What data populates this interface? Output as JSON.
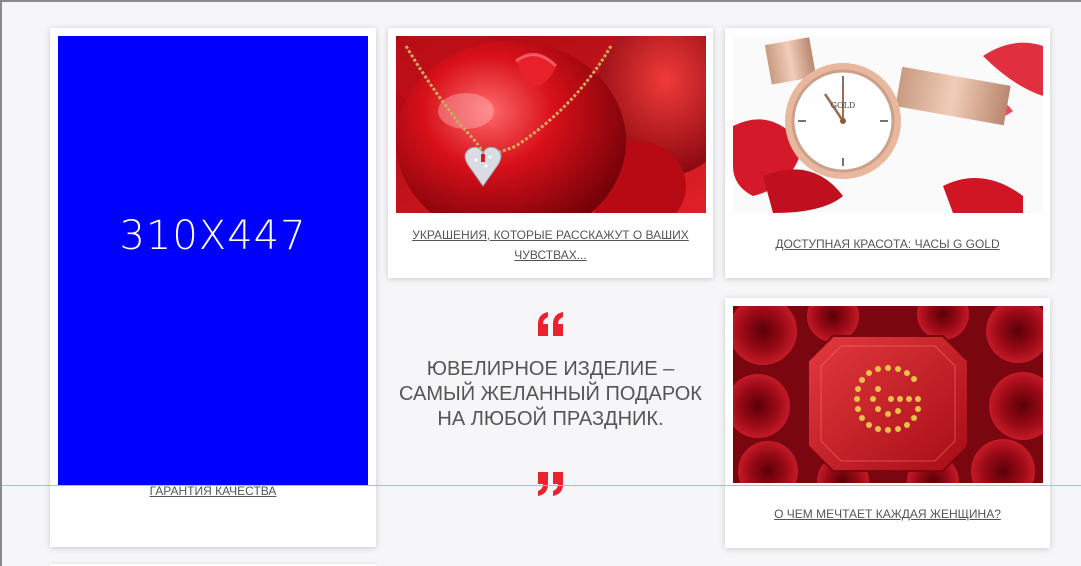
{
  "placeholder": {
    "label": "310X447",
    "color": "#0000ff",
    "link": "ГАРАНТИЯ КАЧЕСТВА"
  },
  "cards": {
    "necklace": {
      "link": "УКРАШЕНИЯ, КОТОРЫЕ РАССКАЖУТ О ВАШИХ ЧУВСТВАХ..."
    },
    "watch": {
      "link": "ДОСТУПНАЯ КРАСОТА: ЧАСЫ G GOLD"
    },
    "box": {
      "link": "О ЧЕМ МЕЧТАЕТ КАЖДАЯ ЖЕНЩИНА?",
      "logo_letter": "G"
    }
  },
  "quote": {
    "text": "ЮВЕЛИРНОЕ ИЗДЕЛИЕ – САМЫЙ ЖЕЛАННЫЙ ПОДАРОК НА ЛЮБОЙ ПРАЗДНИК.",
    "accent_color": "#e8232e"
  },
  "watch_dial_text": "GOLD"
}
